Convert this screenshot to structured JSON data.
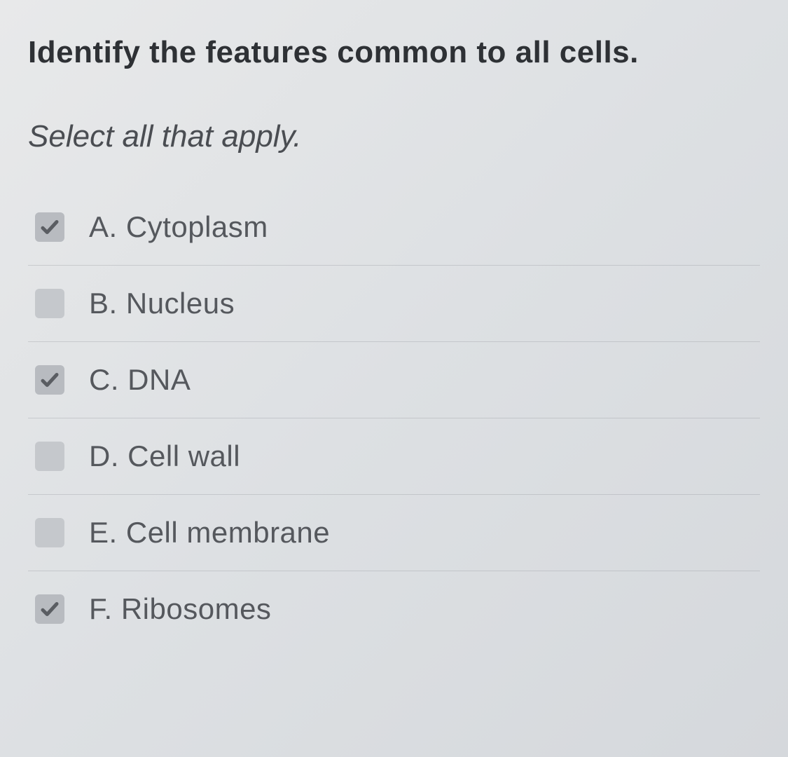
{
  "question": {
    "title": "Identify the features common to all cells.",
    "instruction": "Select all that apply."
  },
  "options": [
    {
      "letter": "A.",
      "label": "Cytoplasm",
      "checked": true
    },
    {
      "letter": "B.",
      "label": "Nucleus",
      "checked": false
    },
    {
      "letter": "C.",
      "label": "DNA",
      "checked": true
    },
    {
      "letter": "D.",
      "label": "Cell wall",
      "checked": false
    },
    {
      "letter": "E.",
      "label": "Cell membrane",
      "checked": false
    },
    {
      "letter": "F.",
      "label": "Ribosomes",
      "checked": true
    }
  ]
}
